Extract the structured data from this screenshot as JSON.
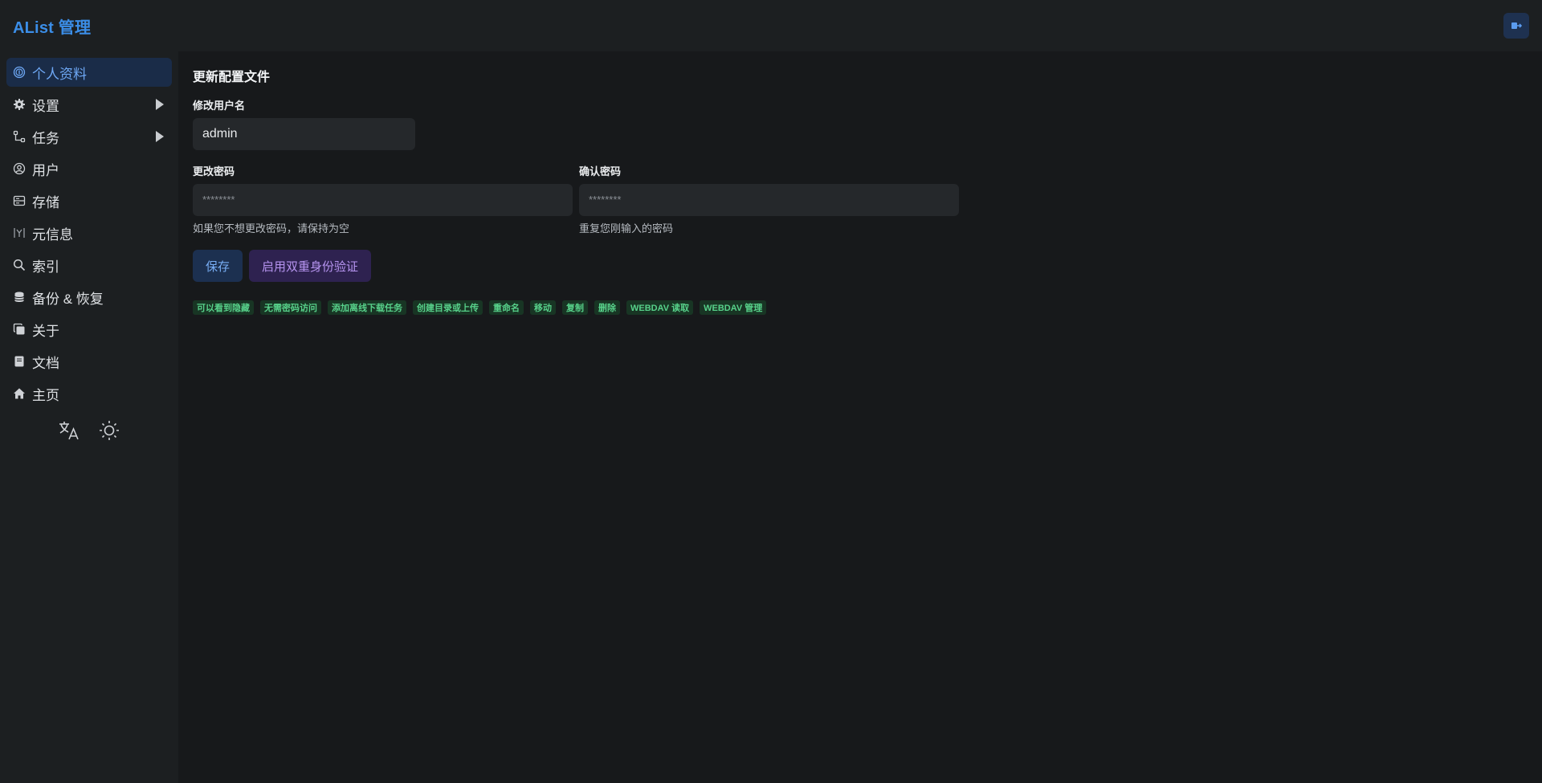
{
  "app": {
    "title": "AList 管理"
  },
  "header": {
    "logout_icon": "logout-icon",
    "accent": "#3b8ee8"
  },
  "sidebar": {
    "items": [
      {
        "label": "个人资料",
        "icon": "fingerprint-icon",
        "active": true
      },
      {
        "label": "设置",
        "icon": "gear-icon",
        "expandable": true
      },
      {
        "label": "任务",
        "icon": "workflow-icon",
        "expandable": true
      },
      {
        "label": "用户",
        "icon": "user-circle-icon"
      },
      {
        "label": "存储",
        "icon": "storage-icon"
      },
      {
        "label": "元信息",
        "icon": "metadata-icon"
      },
      {
        "label": "索引",
        "icon": "search-icon"
      },
      {
        "label": "备份 & 恢复",
        "icon": "database-icon"
      },
      {
        "label": "关于",
        "icon": "copy-icon"
      },
      {
        "label": "文档",
        "icon": "book-icon"
      },
      {
        "label": "主页",
        "icon": "home-icon"
      }
    ],
    "tools": {
      "language_icon": "translate-icon",
      "theme_icon": "sun-icon"
    }
  },
  "main": {
    "title": "更新配置文件",
    "username": {
      "label": "修改用户名",
      "value": "admin"
    },
    "password": {
      "label": "更改密码",
      "placeholder": "********",
      "helper": "如果您不想更改密码，请保持为空"
    },
    "confirm": {
      "label": "确认密码",
      "placeholder": "********",
      "helper": "重复您刚输入的密码"
    },
    "buttons": {
      "save": "保存",
      "enable_2fa": "启用双重身份验证"
    },
    "permissions": [
      "可以看到隐藏",
      "无需密码访问",
      "添加离线下载任务",
      "创建目录或上传",
      "重命名",
      "移动",
      "复制",
      "删除",
      "WEBDAV 读取",
      "WEBDAV 管理"
    ]
  }
}
